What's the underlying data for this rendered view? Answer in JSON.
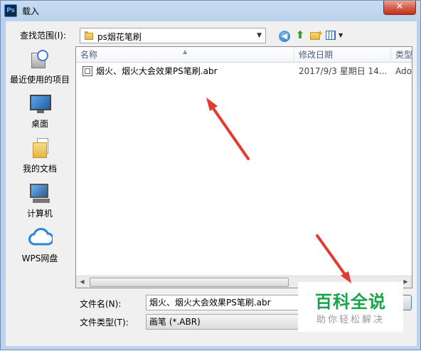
{
  "window": {
    "title": "载入",
    "app_icon": "Ps",
    "close_glyph": "✕"
  },
  "toolbar": {
    "look_in_label": "查找范围(I):",
    "look_in_value": "ps烟花笔刷",
    "back_icon": "back-arrow-icon",
    "back_glyph": "◀",
    "up_icon": "up-folder-icon",
    "up_glyph": "⬆",
    "new_folder_icon": "new-folder-icon",
    "view_icon": "view-menu-icon"
  },
  "places": [
    {
      "label": "最近使用的项目",
      "icon": "recent-items-icon"
    },
    {
      "label": "桌面",
      "icon": "desktop-icon"
    },
    {
      "label": "我的文档",
      "icon": "my-documents-icon"
    },
    {
      "label": "计算机",
      "icon": "computer-icon"
    },
    {
      "label": "WPS网盘",
      "icon": "wps-cloud-icon"
    }
  ],
  "file_list": {
    "columns": [
      "名称",
      "修改日期",
      "类型"
    ],
    "rows": [
      {
        "name": "烟火、烟火大会效果PS笔刷.abr",
        "date": "2017/9/3 星期日 14...",
        "type": "Ado"
      }
    ]
  },
  "footer": {
    "file_name_label": "文件名(N):",
    "file_name_value": "烟火、烟火大会效果PS笔刷.abr",
    "file_type_label": "文件类型(T):",
    "file_type_value": "画笔 (*.ABR)"
  },
  "watermark": {
    "title": "百科全说",
    "subtitle": "助你轻松解决"
  },
  "colors": {
    "annotation_arrow": "#e33b2e",
    "watermark_green": "#17a34a",
    "header_text": "#4c607a"
  }
}
